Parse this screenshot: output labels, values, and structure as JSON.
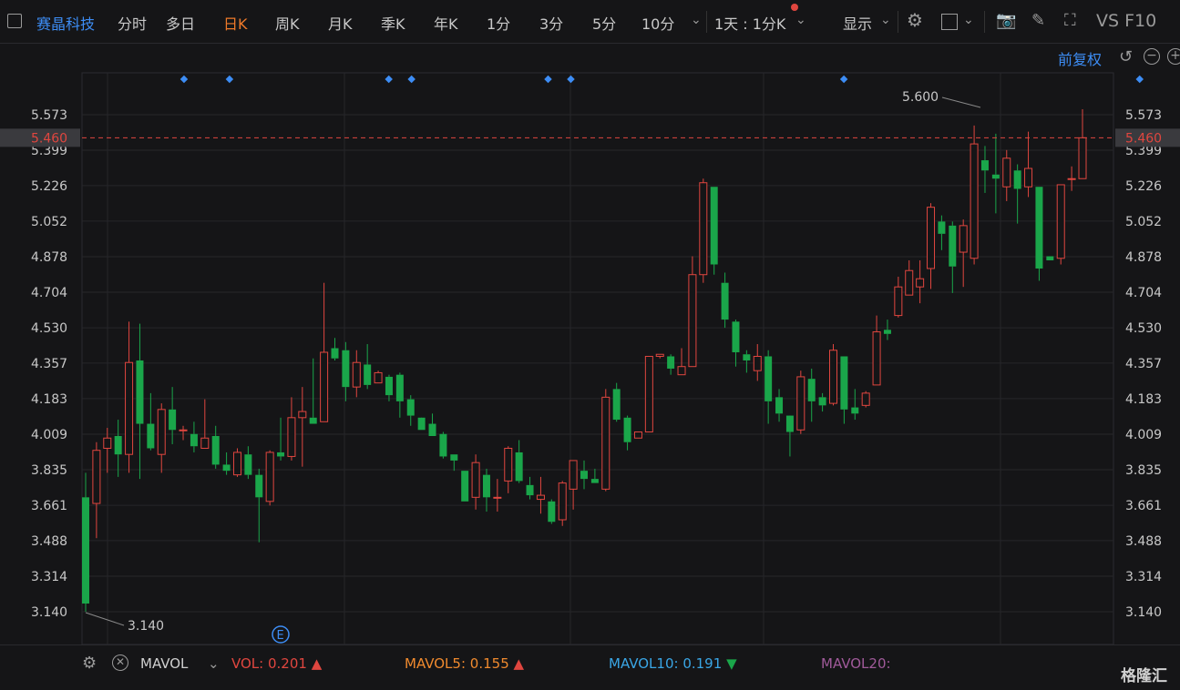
{
  "toolbar": {
    "stock_name": "赛晶科技",
    "tabs": [
      "分时",
      "多日",
      "日K",
      "周K",
      "月K",
      "季K",
      "年K",
      "1分",
      "3分",
      "5分",
      "10分"
    ],
    "active_tab": "日K",
    "period_select": "1天 : 1分K",
    "display_label": "显示",
    "f10_label": "VS  F10"
  },
  "adjust_label": "前复权",
  "chart_data": {
    "type": "candlestick",
    "y_ticks": [
      5.573,
      5.399,
      5.226,
      5.052,
      4.878,
      4.704,
      4.53,
      4.357,
      4.183,
      4.009,
      3.835,
      3.661,
      3.488,
      3.314,
      3.14
    ],
    "y_tick_labels": [
      "5.573",
      "5.399",
      "5.226",
      "5.052",
      "4.878",
      "4.704",
      "4.530",
      "4.357",
      "4.183",
      "4.009",
      "3.835",
      "3.661",
      "3.488",
      "3.314",
      "3.140"
    ],
    "ylim": [
      3.04,
      5.95
    ],
    "current_price": 5.46,
    "current_price_label": "5.460",
    "high_label": "5.600",
    "low_label": "3.140",
    "up_color": "#e0463f",
    "down_color": "#1aa64a",
    "candles": [
      [
        3.7,
        3.18,
        3.82,
        3.14
      ],
      [
        3.67,
        3.93,
        3.97,
        3.5
      ],
      [
        3.94,
        3.99,
        4.04,
        3.82
      ],
      [
        4.0,
        3.91,
        4.08,
        3.8
      ],
      [
        3.91,
        4.36,
        4.56,
        3.82
      ],
      [
        4.37,
        4.06,
        4.55,
        3.79
      ],
      [
        4.06,
        3.94,
        4.21,
        3.93
      ],
      [
        3.91,
        4.13,
        4.16,
        3.82
      ],
      [
        4.13,
        4.03,
        4.24,
        3.96
      ],
      [
        4.03,
        4.03,
        4.05,
        3.98
      ],
      [
        4.01,
        3.95,
        4.07,
        3.92
      ],
      [
        3.94,
        3.99,
        4.18,
        3.94
      ],
      [
        4.0,
        3.86,
        4.05,
        3.84
      ],
      [
        3.86,
        3.83,
        3.92,
        3.81
      ],
      [
        3.81,
        3.92,
        3.94,
        3.8
      ],
      [
        3.91,
        3.81,
        3.95,
        3.79
      ],
      [
        3.81,
        3.7,
        3.84,
        3.48
      ],
      [
        3.68,
        3.92,
        3.93,
        3.66
      ],
      [
        3.92,
        3.9,
        4.09,
        3.88
      ],
      [
        3.9,
        4.09,
        4.19,
        3.88
      ],
      [
        4.09,
        4.12,
        4.24,
        3.85
      ],
      [
        4.09,
        4.06,
        4.38,
        4.06
      ],
      [
        4.07,
        4.41,
        4.75,
        4.07
      ],
      [
        4.43,
        4.38,
        4.48,
        4.37
      ],
      [
        4.42,
        4.24,
        4.46,
        4.17
      ],
      [
        4.24,
        4.36,
        4.42,
        4.19
      ],
      [
        4.35,
        4.25,
        4.45,
        4.23
      ],
      [
        4.26,
        4.31,
        4.32,
        4.26
      ],
      [
        4.29,
        4.2,
        4.3,
        4.17
      ],
      [
        4.3,
        4.17,
        4.31,
        4.09
      ],
      [
        4.18,
        4.1,
        4.2,
        4.05
      ],
      [
        4.09,
        4.03,
        4.08,
        4.03
      ],
      [
        4.06,
        4.0,
        4.11,
        4.0
      ],
      [
        4.01,
        3.9,
        4.02,
        3.89
      ],
      [
        3.91,
        3.88,
        3.91,
        3.83
      ],
      [
        3.83,
        3.68,
        3.83,
        3.68
      ],
      [
        3.7,
        3.87,
        3.91,
        3.64
      ],
      [
        3.81,
        3.7,
        3.84,
        3.63
      ],
      [
        3.7,
        3.7,
        3.79,
        3.63
      ],
      [
        3.78,
        3.94,
        3.95,
        3.72
      ],
      [
        3.92,
        3.78,
        3.98,
        3.77
      ],
      [
        3.76,
        3.71,
        3.8,
        3.69
      ],
      [
        3.69,
        3.71,
        3.8,
        3.62
      ],
      [
        3.68,
        3.58,
        3.69,
        3.57
      ],
      [
        3.59,
        3.77,
        3.78,
        3.56
      ],
      [
        3.74,
        3.88,
        3.88,
        3.64
      ],
      [
        3.83,
        3.79,
        3.88,
        3.74
      ],
      [
        3.79,
        3.77,
        3.84,
        3.77
      ],
      [
        3.74,
        4.19,
        4.23,
        3.73
      ],
      [
        4.23,
        4.08,
        4.26,
        4.07
      ],
      [
        4.09,
        3.97,
        4.1,
        3.93
      ],
      [
        3.99,
        4.02,
        4.02,
        3.99
      ],
      [
        4.02,
        4.39,
        4.39,
        4.02
      ],
      [
        4.39,
        4.4,
        4.4,
        4.38
      ],
      [
        4.39,
        4.33,
        4.4,
        4.3
      ],
      [
        4.3,
        4.34,
        4.43,
        4.33
      ],
      [
        4.34,
        4.79,
        4.88,
        4.34
      ],
      [
        4.79,
        5.24,
        5.26,
        4.75
      ],
      [
        5.22,
        4.84,
        5.22,
        4.79
      ],
      [
        4.75,
        4.57,
        4.8,
        4.53
      ],
      [
        4.56,
        4.41,
        4.57,
        4.34
      ],
      [
        4.4,
        4.37,
        4.42,
        4.31
      ],
      [
        4.32,
        4.39,
        4.45,
        4.27
      ],
      [
        4.39,
        4.17,
        4.42,
        4.06
      ],
      [
        4.19,
        4.11,
        4.23,
        4.07
      ],
      [
        4.1,
        4.02,
        4.09,
        3.9
      ],
      [
        4.03,
        4.29,
        4.32,
        4.01
      ],
      [
        4.28,
        4.17,
        4.33,
        4.07
      ],
      [
        4.19,
        4.15,
        4.21,
        4.12
      ],
      [
        4.16,
        4.42,
        4.45,
        4.15
      ],
      [
        4.39,
        4.13,
        4.39,
        4.06
      ],
      [
        4.14,
        4.11,
        4.23,
        4.08
      ],
      [
        4.15,
        4.21,
        4.22,
        4.14
      ],
      [
        4.25,
        4.51,
        4.59,
        4.28
      ],
      [
        4.52,
        4.5,
        4.57,
        4.47
      ],
      [
        4.59,
        4.73,
        4.78,
        4.58
      ],
      [
        4.69,
        4.81,
        4.86,
        4.69
      ],
      [
        4.73,
        4.77,
        4.86,
        4.65
      ],
      [
        4.82,
        5.12,
        5.14,
        4.72
      ],
      [
        5.05,
        4.99,
        5.08,
        4.91
      ],
      [
        5.03,
        4.83,
        5.05,
        4.7
      ],
      [
        4.9,
        5.03,
        5.06,
        4.73
      ],
      [
        4.87,
        5.43,
        5.52,
        4.84
      ],
      [
        5.35,
        5.3,
        5.42,
        5.19
      ],
      [
        5.28,
        5.26,
        5.48,
        5.09
      ],
      [
        5.22,
        5.36,
        5.4,
        5.15
      ],
      [
        5.3,
        5.21,
        5.33,
        5.04
      ],
      [
        5.22,
        5.31,
        5.49,
        5.17
      ],
      [
        5.22,
        4.82,
        5.22,
        4.76
      ],
      [
        4.88,
        4.86,
        4.86,
        4.86
      ],
      [
        4.87,
        5.23,
        5.23,
        4.84
      ],
      [
        5.26,
        5.26,
        5.32,
        5.2
      ],
      [
        5.26,
        5.46,
        5.6,
        5.26
      ]
    ],
    "markers_top_x_index": [
      2,
      4,
      11,
      12,
      18,
      19,
      31,
      44,
      46,
      56
    ],
    "earnings_marker_label": "E"
  },
  "volume_bar": {
    "indicator": "MAVOL",
    "vol_label": "VOL:",
    "vol_value": "0.201",
    "mavol5_label": "MAVOL5:",
    "mavol5_value": "0.155",
    "mavol10_label": "MAVOL10:",
    "mavol10_value": "0.191",
    "mavol20_label": "MAVOL20:",
    "colors": {
      "vol": "#e0463f",
      "mavol5": "#f08a2e",
      "mavol10": "#3aa6e6",
      "mavol20": "#a05a9a"
    }
  },
  "brand": "格隆汇"
}
